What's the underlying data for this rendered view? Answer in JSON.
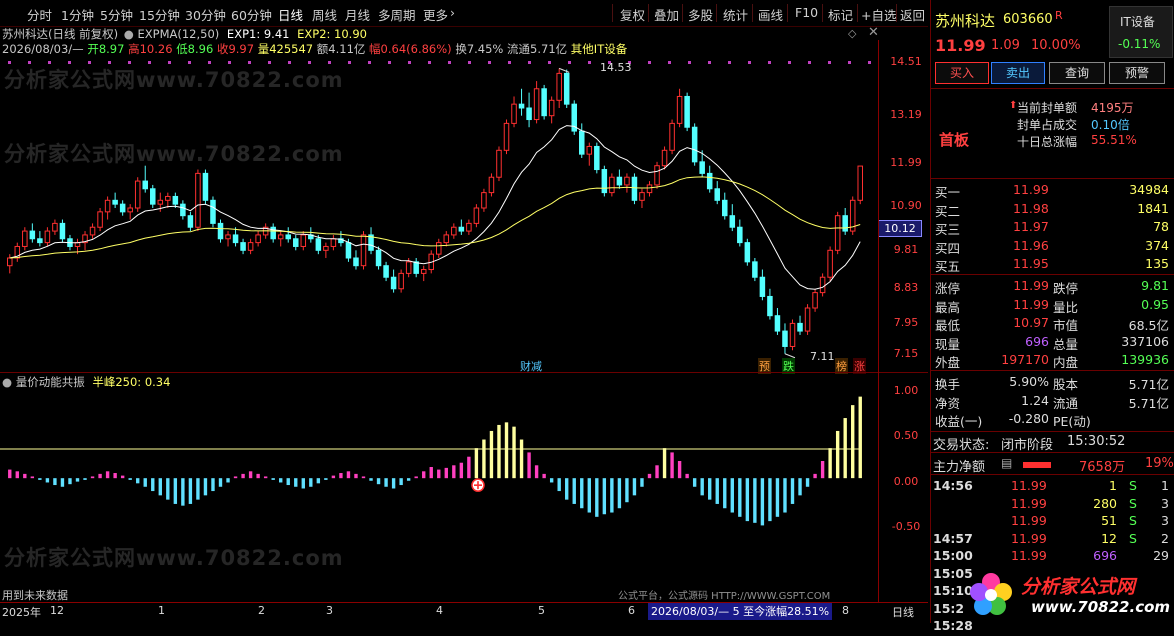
{
  "toolbar": {
    "periods": [
      "分时",
      "1分钟",
      "5分钟",
      "15分钟",
      "30分钟",
      "60分钟",
      "日线",
      "周线",
      "月线",
      "多周期",
      "更多"
    ],
    "actions": [
      "复权",
      "叠加",
      "多股",
      "统计",
      "画线",
      "F10",
      "标记",
      "+自选",
      "返回"
    ]
  },
  "info": {
    "title": "苏州科达(日线 前复权)",
    "indicator": "EXPMA(12,50)",
    "exp1": "EXP1: 9.41",
    "exp2": "EXP2: 10.90",
    "date": "2026/08/03/—",
    "open": "开8.97",
    "high": "高10.26",
    "low": "低8.96",
    "close": "收9.97",
    "volume": "量425547",
    "amount": "额4.11亿",
    "range": "幅0.64(6.86%)",
    "turnover": "换7.45%",
    "float": "流通5.71亿",
    "sector": "其他IT设备"
  },
  "price_axis": [
    "14.51",
    "13.19",
    "11.99",
    "10.90",
    "9.81",
    "8.83",
    "7.95",
    "7.15"
  ],
  "price_current": "10.12",
  "annotations": {
    "high": "14.53",
    "low": "7.11",
    "finance": "财减",
    "pre": "预",
    "fall": "跌",
    "rank": "榜",
    "rise": "涨"
  },
  "indicator_panel": {
    "name": "量价动能共振",
    "param": "半峰250: 0.34",
    "axis": [
      "1.00",
      "0.50",
      "0.00",
      "-0.50"
    ]
  },
  "bottom": {
    "future": "用到未来数据",
    "source": "公式平台，公式源码 HTTP://WWW.GSPT.COM",
    "year": "2025年",
    "months": [
      "12",
      "1",
      "2",
      "3",
      "4",
      "5",
      "6",
      "8"
    ],
    "range_label": "2026/08/03/— 5 至今涨幅28.51%",
    "period": "日线"
  },
  "watermarks": [
    "分析家公式网www.70822.com",
    "分析家公式网www.70822.com",
    "分析家公式网www.70822.com"
  ],
  "stock": {
    "name": "苏州科达",
    "code": "603660",
    "flag": "R",
    "industry": "IT设备",
    "industry_change": "-0.11%",
    "price": "11.99",
    "change": "1.09",
    "pct": "10.00%",
    "buttons": [
      "买入",
      "卖出",
      "查询",
      "预警"
    ],
    "seal_amount_label": "当前封单额",
    "seal_amount": "4195万",
    "seal_ratio_label": "封单占成交",
    "seal_ratio": "0.10倍",
    "ten_day_label": "十日总涨幅",
    "ten_day": "55.51%",
    "tag": "首板"
  },
  "order_book": [
    {
      "label": "买一",
      "price": "11.99",
      "vol": "34984"
    },
    {
      "label": "买二",
      "price": "11.98",
      "vol": "1841"
    },
    {
      "label": "买三",
      "price": "11.97",
      "vol": "78"
    },
    {
      "label": "买四",
      "price": "11.96",
      "vol": "374"
    },
    {
      "label": "买五",
      "price": "11.95",
      "vol": "135"
    }
  ],
  "quote": {
    "limit_up_label": "涨停",
    "limit_up": "11.99",
    "limit_down_label": "跌停",
    "limit_down": "9.81",
    "high_label": "最高",
    "high": "11.99",
    "vol_ratio_label": "量比",
    "vol_ratio": "0.95",
    "low_label": "最低",
    "low": "10.97",
    "mktcap_label": "市值",
    "mktcap": "68.5亿",
    "now_vol_label": "现量",
    "now_vol": "696",
    "total_vol_label": "总量",
    "total_vol": "337106",
    "outer_label": "外盘",
    "outer": "197170",
    "inner_label": "内盘",
    "inner": "139936",
    "turnover_label": "换手",
    "turnover": "5.90%",
    "shares_label": "股本",
    "shares": "5.71亿",
    "netasset_label": "净资",
    "netasset": "1.24",
    "float_label": "流通",
    "float": "5.71亿",
    "eps_label": "收益(一)",
    "eps": "-0.280",
    "pe_label": "PE(动)",
    "pe": "",
    "status_label": "交易状态:",
    "status": "闭市阶段",
    "status_time": "15:30:52",
    "mainflow_label": "主力净额",
    "mainflow": "7658万",
    "mainflow_pct": "19%"
  },
  "ticks": [
    {
      "time": "14:56",
      "price": "11.99",
      "vol": "1",
      "side": "S",
      "num": "1"
    },
    {
      "time": "",
      "price": "11.99",
      "vol": "280",
      "side": "S",
      "num": "3"
    },
    {
      "time": "",
      "price": "11.99",
      "vol": "51",
      "side": "S",
      "num": "3"
    },
    {
      "time": "14:57",
      "price": "11.99",
      "vol": "12",
      "side": "S",
      "num": "2"
    },
    {
      "time": "15:00",
      "price": "11.99",
      "vol": "696",
      "side": "",
      "num": "29"
    },
    {
      "time": "15:05",
      "price": "",
      "vol": "",
      "side": "",
      "num": ""
    },
    {
      "time": "15:10",
      "price": "",
      "vol": "",
      "side": "",
      "num": ""
    },
    {
      "time": "15:2",
      "price": "",
      "vol": "",
      "side": "",
      "num": ""
    },
    {
      "time": "15:28",
      "price": "",
      "vol": "",
      "side": "",
      "num": ""
    }
  ],
  "brand": {
    "name": "分析家公式网",
    "url": "www.70822.com"
  },
  "colors": {
    "up": "#ff3030",
    "down": "#54ffff",
    "ma1": "#ffffff",
    "ma2": "#ffff66",
    "label": "#c0c0c0",
    "axis": "#ff3030"
  },
  "chart_data": {
    "type": "candlestick",
    "ylim": [
      7.0,
      14.8
    ],
    "candles": [
      [
        9.4,
        9.7,
        9.2,
        9.6
      ],
      [
        9.6,
        10.0,
        9.5,
        9.9
      ],
      [
        9.9,
        10.4,
        9.8,
        10.3
      ],
      [
        10.3,
        10.5,
        10.0,
        10.1
      ],
      [
        10.1,
        10.3,
        9.9,
        10.0
      ],
      [
        10.0,
        10.4,
        9.9,
        10.3
      ],
      [
        10.3,
        10.6,
        10.2,
        10.5
      ],
      [
        10.5,
        10.6,
        10.0,
        10.1
      ],
      [
        10.1,
        10.2,
        9.8,
        9.9
      ],
      [
        9.9,
        10.1,
        9.7,
        10.0
      ],
      [
        10.0,
        10.3,
        9.8,
        10.2
      ],
      [
        10.2,
        10.5,
        10.1,
        10.4
      ],
      [
        10.4,
        10.9,
        10.3,
        10.8
      ],
      [
        10.8,
        11.2,
        10.6,
        11.1
      ],
      [
        11.1,
        11.3,
        10.9,
        11.0
      ],
      [
        11.0,
        11.1,
        10.7,
        10.8
      ],
      [
        10.8,
        11.0,
        10.6,
        10.9
      ],
      [
        10.9,
        11.7,
        10.8,
        11.6
      ],
      [
        11.6,
        12.0,
        11.3,
        11.4
      ],
      [
        11.4,
        11.5,
        10.9,
        11.0
      ],
      [
        11.0,
        11.3,
        10.8,
        11.1
      ],
      [
        11.1,
        11.3,
        10.9,
        11.2
      ],
      [
        11.2,
        11.3,
        10.9,
        11.0
      ],
      [
        11.0,
        11.1,
        10.6,
        10.7
      ],
      [
        10.7,
        10.8,
        10.3,
        10.4
      ],
      [
        10.4,
        11.9,
        10.3,
        11.8
      ],
      [
        11.8,
        11.9,
        11.0,
        11.1
      ],
      [
        11.1,
        11.2,
        10.4,
        10.5
      ],
      [
        10.5,
        10.6,
        10.0,
        10.1
      ],
      [
        10.1,
        10.3,
        9.9,
        10.2
      ],
      [
        10.2,
        10.4,
        9.9,
        10.0
      ],
      [
        10.0,
        10.1,
        9.7,
        9.8
      ],
      [
        9.8,
        10.1,
        9.7,
        10.0
      ],
      [
        10.0,
        10.3,
        9.9,
        10.2
      ],
      [
        10.2,
        10.5,
        10.1,
        10.4
      ],
      [
        10.4,
        10.5,
        10.0,
        10.1
      ],
      [
        10.1,
        10.3,
        9.9,
        10.2
      ],
      [
        10.2,
        10.4,
        10.0,
        10.1
      ],
      [
        10.1,
        10.2,
        9.8,
        9.9
      ],
      [
        9.9,
        10.3,
        9.8,
        10.2
      ],
      [
        10.2,
        10.4,
        10.0,
        10.1
      ],
      [
        10.1,
        10.2,
        9.7,
        9.8
      ],
      [
        9.8,
        10.0,
        9.6,
        9.9
      ],
      [
        9.9,
        10.2,
        9.8,
        10.1
      ],
      [
        10.1,
        10.3,
        9.9,
        10.0
      ],
      [
        10.0,
        10.1,
        9.5,
        9.6
      ],
      [
        9.6,
        9.8,
        9.3,
        9.4
      ],
      [
        9.4,
        10.3,
        9.3,
        10.2
      ],
      [
        10.2,
        10.4,
        9.7,
        9.8
      ],
      [
        9.8,
        9.9,
        9.3,
        9.4
      ],
      [
        9.4,
        9.5,
        9.0,
        9.1
      ],
      [
        9.1,
        9.3,
        8.7,
        8.8
      ],
      [
        8.8,
        9.3,
        8.7,
        9.2
      ],
      [
        9.2,
        9.6,
        9.1,
        9.5
      ],
      [
        9.5,
        9.6,
        9.1,
        9.2
      ],
      [
        9.2,
        9.4,
        9.0,
        9.3
      ],
      [
        9.3,
        9.8,
        9.2,
        9.7
      ],
      [
        9.7,
        10.1,
        9.6,
        10.0
      ],
      [
        10.0,
        10.3,
        9.9,
        10.2
      ],
      [
        10.2,
        10.5,
        10.1,
        10.4
      ],
      [
        10.4,
        10.6,
        10.2,
        10.3
      ],
      [
        10.3,
        10.6,
        10.2,
        10.5
      ],
      [
        10.5,
        11.0,
        10.4,
        10.9
      ],
      [
        10.9,
        11.4,
        10.8,
        11.3
      ],
      [
        11.3,
        11.8,
        11.2,
        11.7
      ],
      [
        11.7,
        12.5,
        11.6,
        12.4
      ],
      [
        12.4,
        13.2,
        12.3,
        13.1
      ],
      [
        13.1,
        13.8,
        13.0,
        13.6
      ],
      [
        13.6,
        14.0,
        13.3,
        13.5
      ],
      [
        13.5,
        13.9,
        13.0,
        13.2
      ],
      [
        13.2,
        14.2,
        13.1,
        14.0
      ],
      [
        14.0,
        14.1,
        13.2,
        13.3
      ],
      [
        13.3,
        13.8,
        13.1,
        13.7
      ],
      [
        13.7,
        14.53,
        13.5,
        14.4
      ],
      [
        14.4,
        14.5,
        13.5,
        13.6
      ],
      [
        13.6,
        13.7,
        12.8,
        12.9
      ],
      [
        12.9,
        13.1,
        12.2,
        12.3
      ],
      [
        12.3,
        12.6,
        12.0,
        12.5
      ],
      [
        12.5,
        12.6,
        11.8,
        11.9
      ],
      [
        11.9,
        12.0,
        11.2,
        11.3
      ],
      [
        11.3,
        11.8,
        11.2,
        11.7
      ],
      [
        11.7,
        11.9,
        11.4,
        11.5
      ],
      [
        11.5,
        11.8,
        11.3,
        11.7
      ],
      [
        11.7,
        11.8,
        11.0,
        11.1
      ],
      [
        11.1,
        11.4,
        10.9,
        11.3
      ],
      [
        11.3,
        11.6,
        11.2,
        11.5
      ],
      [
        11.5,
        12.1,
        11.4,
        12.0
      ],
      [
        12.0,
        12.5,
        11.9,
        12.4
      ],
      [
        12.4,
        13.2,
        12.3,
        13.1
      ],
      [
        13.1,
        14.0,
        13.0,
        13.8
      ],
      [
        13.8,
        13.9,
        12.9,
        13.0
      ],
      [
        13.0,
        13.1,
        12.0,
        12.1
      ],
      [
        12.1,
        12.4,
        11.7,
        11.8
      ],
      [
        11.8,
        12.0,
        11.3,
        11.4
      ],
      [
        11.4,
        11.6,
        11.0,
        11.1
      ],
      [
        11.1,
        11.3,
        10.6,
        10.7
      ],
      [
        10.7,
        11.0,
        10.3,
        10.4
      ],
      [
        10.4,
        10.6,
        9.9,
        10.0
      ],
      [
        10.0,
        10.1,
        9.4,
        9.5
      ],
      [
        9.5,
        9.6,
        9.0,
        9.1
      ],
      [
        9.1,
        9.3,
        8.5,
        8.6
      ],
      [
        8.6,
        8.8,
        8.0,
        8.1
      ],
      [
        8.1,
        8.3,
        7.6,
        7.7
      ],
      [
        7.7,
        7.9,
        7.11,
        7.3
      ],
      [
        7.3,
        8.0,
        7.2,
        7.9
      ],
      [
        7.9,
        8.1,
        7.6,
        7.7
      ],
      [
        7.7,
        8.4,
        7.6,
        8.3
      ],
      [
        8.3,
        8.8,
        8.2,
        8.7
      ],
      [
        8.7,
        9.2,
        8.6,
        9.1
      ],
      [
        9.1,
        9.9,
        9.0,
        9.8
      ],
      [
        9.8,
        10.8,
        9.7,
        10.7
      ],
      [
        10.7,
        10.9,
        10.2,
        10.3
      ],
      [
        10.3,
        11.2,
        10.2,
        11.1
      ],
      [
        11.1,
        11.99,
        11.0,
        11.99
      ]
    ],
    "indicator": [
      0.1,
      0.08,
      0.05,
      0.02,
      -0.02,
      -0.05,
      -0.08,
      -0.1,
      -0.07,
      -0.04,
      -0.02,
      0.02,
      0.05,
      0.08,
      0.06,
      0.03,
      -0.02,
      -0.06,
      -0.1,
      -0.15,
      -0.2,
      -0.25,
      -0.3,
      -0.32,
      -0.3,
      -0.25,
      -0.2,
      -0.15,
      -0.1,
      -0.05,
      0.02,
      0.05,
      0.08,
      0.05,
      0.02,
      -0.02,
      -0.05,
      -0.08,
      -0.1,
      -0.12,
      -0.1,
      -0.06,
      -0.02,
      0.03,
      0.06,
      0.08,
      0.05,
      0.02,
      -0.03,
      -0.07,
      -0.1,
      -0.12,
      -0.08,
      -0.03,
      0.02,
      0.08,
      0.13,
      0.1,
      0.12,
      0.15,
      0.18,
      0.25,
      0.35,
      0.45,
      0.55,
      0.62,
      0.65,
      0.6,
      0.45,
      0.3,
      0.15,
      0.05,
      -0.05,
      -0.15,
      -0.25,
      -0.3,
      -0.35,
      -0.4,
      -0.45,
      -0.42,
      -0.4,
      -0.35,
      -0.28,
      -0.2,
      -0.1,
      0.05,
      0.15,
      0.35,
      0.3,
      0.2,
      0.05,
      -0.1,
      -0.2,
      -0.25,
      -0.3,
      -0.35,
      -0.4,
      -0.45,
      -0.5,
      -0.52,
      -0.55,
      -0.5,
      -0.45,
      -0.4,
      -0.3,
      -0.2,
      -0.1,
      0.05,
      0.2,
      0.35,
      0.55,
      0.7,
      0.85,
      0.95
    ]
  }
}
